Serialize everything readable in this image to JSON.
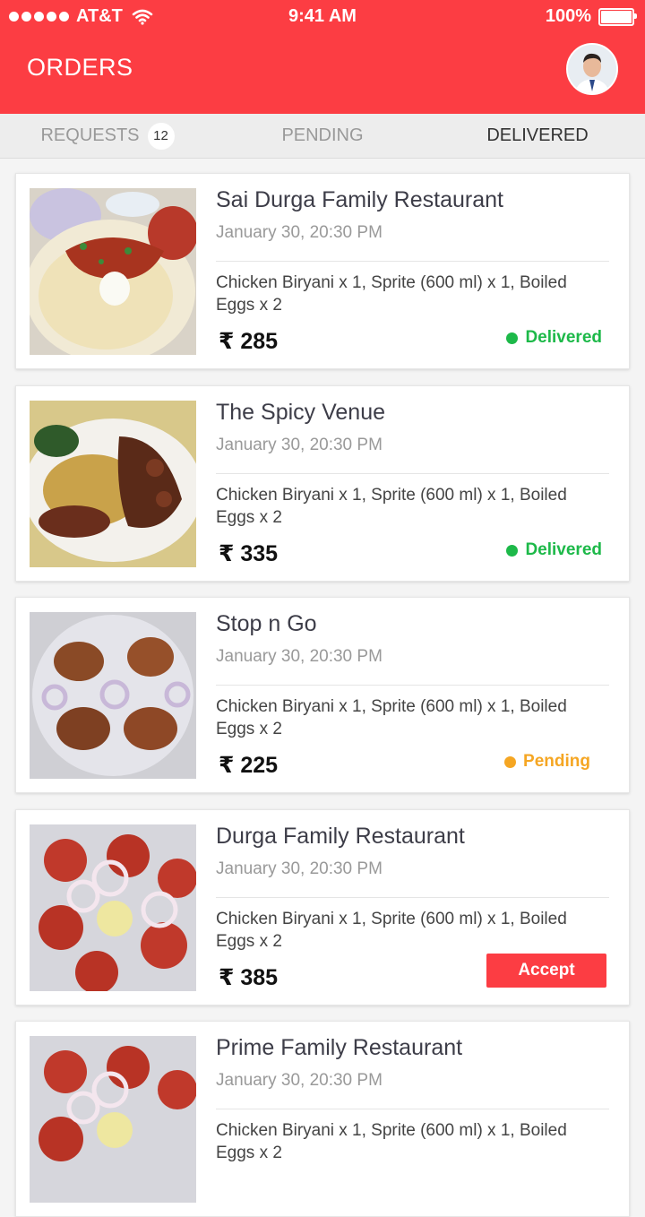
{
  "status_bar": {
    "carrier": "AT&T",
    "time": "9:41 AM",
    "battery": "100%",
    "battery_level": 1.0
  },
  "header": {
    "title": "ORDERS"
  },
  "tabs": [
    {
      "label": "REQUESTS",
      "badge": "12"
    },
    {
      "label": "PENDING"
    },
    {
      "label": "DELIVERED"
    }
  ],
  "orders": [
    {
      "name": "Sai Durga Family Restaurant",
      "date": "January 30, 20:30 PM",
      "items": "Chicken Biryani x 1, Sprite (600 ml) x 1, Boiled Eggs x 2",
      "price": "₹ 285",
      "status": "Delivered",
      "status_color": "#1db949"
    },
    {
      "name": "The Spicy Venue",
      "date": "January 30, 20:30 PM",
      "items": "Chicken Biryani x 1, Sprite (600 ml) x 1, Boiled Eggs x 2",
      "price": "₹ 335",
      "status": "Delivered",
      "status_color": "#1db949"
    },
    {
      "name": "Stop n Go",
      "date": "January 30, 20:30 PM",
      "items": "Chicken Biryani x 1, Sprite (600 ml) x 1, Boiled Eggs x 2",
      "price": "₹ 225",
      "status": "Pending",
      "status_color": "#f5a623"
    },
    {
      "name": "Durga Family Restaurant",
      "date": "January 30, 20:30 PM",
      "items": "Chicken Biryani x 1, Sprite (600 ml) x 1, Boiled Eggs x 2",
      "price": "₹ 385",
      "action": "Accept"
    },
    {
      "name": "Prime Family Restaurant",
      "date": "January 30, 20:30 PM",
      "items": "Chicken Biryani x 1, Sprite (600 ml) x 1, Boiled Eggs x 2",
      "price": ""
    }
  ],
  "colors": {
    "accent": "#fc3d43",
    "delivered": "#1db949",
    "pending": "#f5a623"
  }
}
